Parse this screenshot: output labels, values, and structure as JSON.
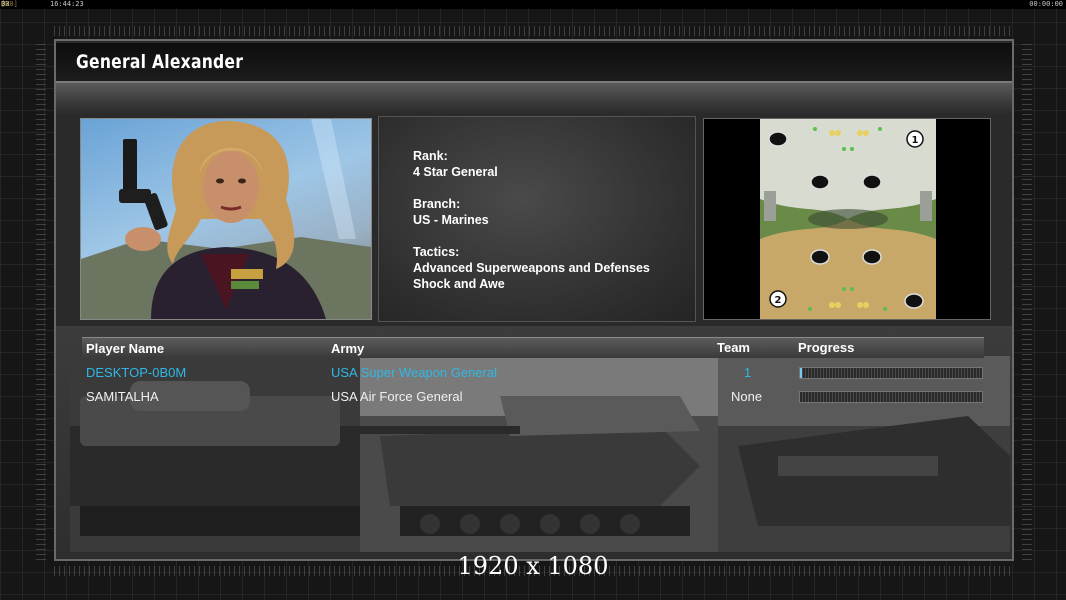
{
  "overlay": {
    "fps_label": "UR",
    "fps_value": "30",
    "fps_value2": "32",
    "fps_cap": "[60]",
    "clock": "16:44:23",
    "timer": "00:00:00"
  },
  "title": "General Alexander",
  "general_info": {
    "rank_label": "Rank:",
    "rank_value": "4 Star General",
    "branch_label": "Branch:",
    "branch_value": "US - Marines",
    "tactics_label": "Tactics:",
    "tactics_line1": "Advanced Superweapons and Defenses",
    "tactics_line2": "Shock and Awe"
  },
  "map": {
    "start_positions": [
      "1",
      "2"
    ]
  },
  "player_table": {
    "headers": {
      "name": "Player Name",
      "army": "Army",
      "team": "Team",
      "progress": "Progress"
    },
    "rows": [
      {
        "name": "DESKTOP-0B0M",
        "army": "USA Super Weapon General",
        "team": "1",
        "progress": 0.01,
        "color": "#2fb8e6"
      },
      {
        "name": "SAMITALHA",
        "army": "USA Air Force General",
        "team": "None",
        "progress": 0.0,
        "color": "#f0f0f0"
      }
    ]
  },
  "resolution_watermark": "1920 x 1080"
}
